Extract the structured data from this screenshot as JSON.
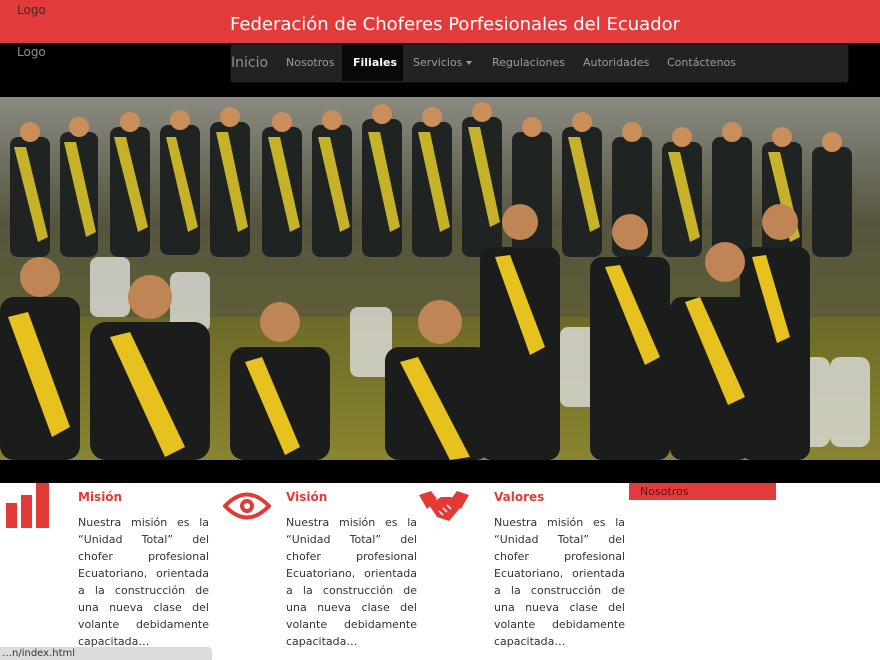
{
  "header": {
    "logo_top": "Logo",
    "title": "Federación de Choferes Porfesionales del Ecuador",
    "brand_color": "#e33b3c"
  },
  "nav": {
    "logo": "Logo",
    "brand": "Inicio",
    "items": [
      {
        "label": "Nosotros",
        "active": false
      },
      {
        "label": "Filiales",
        "active": true
      },
      {
        "label": "Servicios",
        "active": false,
        "dropdown": true
      },
      {
        "label": "Regulaciones",
        "active": false
      },
      {
        "label": "Autoridades",
        "active": false
      },
      {
        "label": "Contáctenos",
        "active": false
      }
    ]
  },
  "hero": {
    "image": "photo of graduating drivers in dark suits with yellow sashes standing in a hall"
  },
  "features": [
    {
      "icon": "bar-chart-icon",
      "title": "Misión",
      "text": "Nuestra misión es la “Unidad Total” del chofer profesional Ecuatoriano, orientada a la construcción de una nueva clase del volante debidamente capacitada…"
    },
    {
      "icon": "eye-icon",
      "title": "Visión",
      "text": "Nuestra misión es la “Unidad Total” del chofer profesional Ecuatoriano, orientada a la construcción de una nueva clase del volante debidamente capacitada…"
    },
    {
      "icon": "handshake-icon",
      "title": "Valores",
      "text": "Nuestra misión es la “Unidad Total” del chofer profesional Ecuatoriano, orientada a la construcción de una nueva clase del volante debidamente capacitada…"
    }
  ],
  "sidebar": {
    "label": "Nosotros"
  },
  "status": {
    "url": "…n/index.html"
  }
}
